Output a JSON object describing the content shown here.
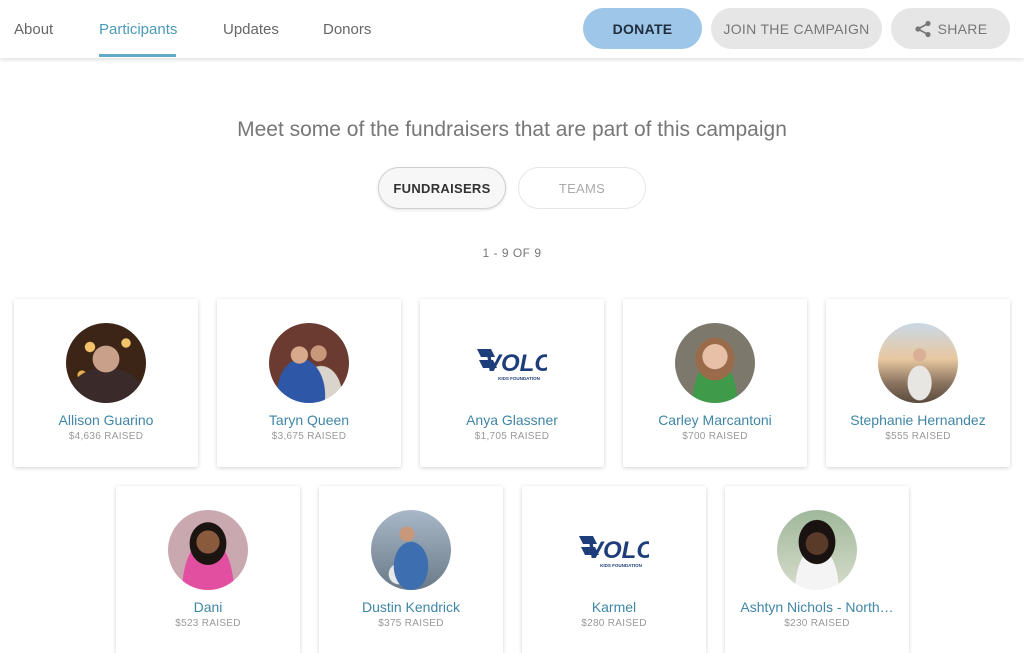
{
  "nav": {
    "tabs": [
      {
        "label": "About"
      },
      {
        "label": "Participants"
      },
      {
        "label": "Updates"
      },
      {
        "label": "Donors"
      }
    ],
    "donate_label": "DONATE",
    "join_label": "JOIN THE CAMPAIGN",
    "share_label": "SHARE"
  },
  "heading": "Meet some of the fundraisers that are part of this campaign",
  "toggle": {
    "fundraisers": "FUNDRAISERS",
    "teams": "TEAMS"
  },
  "count": "1 - 9 OF 9",
  "logo_text": "VOLO",
  "logo_sub": "KIDS FOUNDATION",
  "colors": {
    "accent": "#4a9ab8",
    "donate_bg": "#9dc6e8",
    "volo_blue": "#1e3d7b"
  },
  "fundraisers": [
    {
      "name": "Allison Guarino",
      "raised": "$4,636 RAISED",
      "avatar": "photo"
    },
    {
      "name": "Taryn Queen",
      "raised": "$3,675 RAISED",
      "avatar": "photo"
    },
    {
      "name": "Anya Glassner",
      "raised": "$1,705 RAISED",
      "avatar": "volo-logo"
    },
    {
      "name": "Carley Marcantoni",
      "raised": "$700 RAISED",
      "avatar": "photo"
    },
    {
      "name": "Stephanie Hernandez",
      "raised": "$555 RAISED",
      "avatar": "photo"
    },
    {
      "name": "Dani",
      "raised": "$523 RAISED",
      "avatar": "photo"
    },
    {
      "name": "Dustin Kendrick",
      "raised": "$375 RAISED",
      "avatar": "photo"
    },
    {
      "name": "Karmel",
      "raised": "$280 RAISED",
      "avatar": "volo-logo"
    },
    {
      "name": "Ashtyn Nichols - North…",
      "raised": "$230 RAISED",
      "avatar": "photo"
    }
  ]
}
